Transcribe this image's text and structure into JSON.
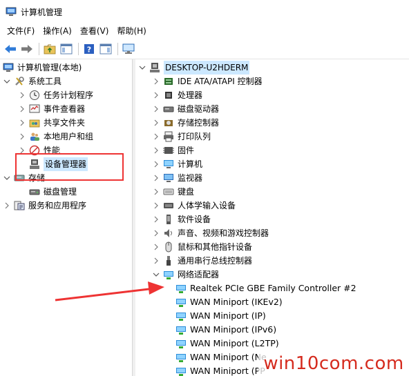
{
  "window": {
    "title": "计算机管理"
  },
  "menu": {
    "file": "文件(F)",
    "action": "操作(A)",
    "view": "查看(V)",
    "help": "帮助(H)"
  },
  "left_tree": {
    "root": "计算机管理(本地)",
    "system_tools": "系统工具",
    "task_scheduler": "任务计划程序",
    "event_viewer": "事件查看器",
    "shared_folders": "共享文件夹",
    "local_users": "本地用户和组",
    "performance": "性能",
    "device_manager": "设备管理器",
    "storage": "存储",
    "disk_management": "磁盘管理",
    "services_apps": "服务和应用程序"
  },
  "device_tree": {
    "computer_name": "DESKTOP-U2HDERM",
    "categories": [
      "IDE ATA/ATAPI 控制器",
      "处理器",
      "磁盘驱动器",
      "存储控制器",
      "打印队列",
      "固件",
      "计算机",
      "监视器",
      "键盘",
      "人体学输入设备",
      "软件设备",
      "声音、视频和游戏控制器",
      "鼠标和其他指针设备",
      "通用串行总线控制器",
      "网络适配器"
    ],
    "network_adapters": [
      "Realtek PCIe GBE Family Controller #2",
      "WAN Miniport (IKEv2)",
      "WAN Miniport (IP)",
      "WAN Miniport (IPv6)",
      "WAN Miniport (L2TP)",
      "WAN Miniport (Ne",
      "WAN Miniport (PP"
    ]
  },
  "watermark": {
    "text": "win10com.com"
  },
  "colors": {
    "selection": "#cce8ff",
    "annotation_red": "#e33333",
    "watermark_red": "#d52b1e"
  }
}
